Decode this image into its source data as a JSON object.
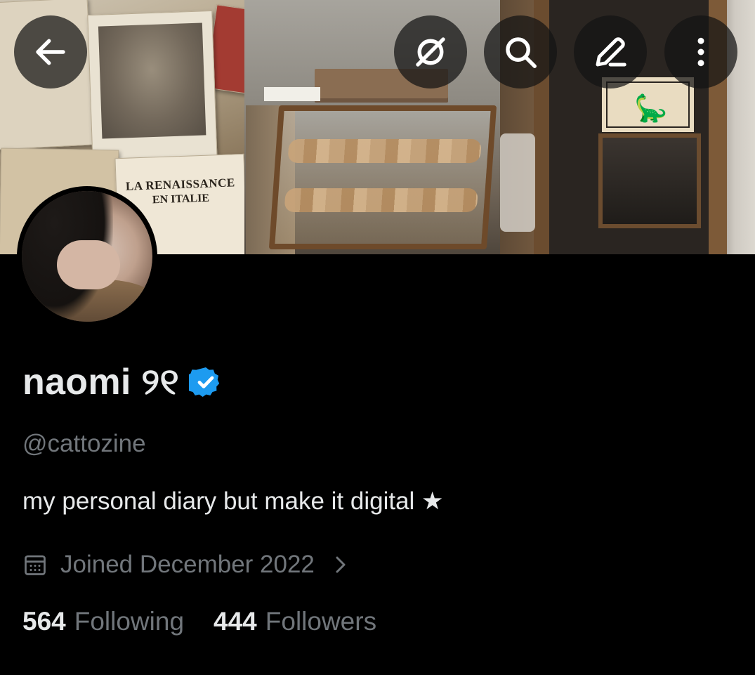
{
  "header": {
    "back_icon": "arrow-left-icon",
    "actions": [
      "grok-icon",
      "search-icon",
      "edit-icon",
      "more-vertical-icon"
    ]
  },
  "banner": {
    "book_title_line1": "LA RENAISSANCE",
    "book_title_line2": "EN ITALIE"
  },
  "profile": {
    "name": "naomi ୨୧",
    "verified": true,
    "handle": "@cattozine",
    "bio": "my personal diary but make it digital ★",
    "joined": "Joined December 2022",
    "following_count": "564",
    "following_label": "Following",
    "followers_count": "444",
    "followers_label": "Followers"
  },
  "colors": {
    "background": "#000000",
    "primary_text": "#e7e9ea",
    "secondary_text": "#71767b",
    "verified_blue": "#1d9bf0"
  }
}
